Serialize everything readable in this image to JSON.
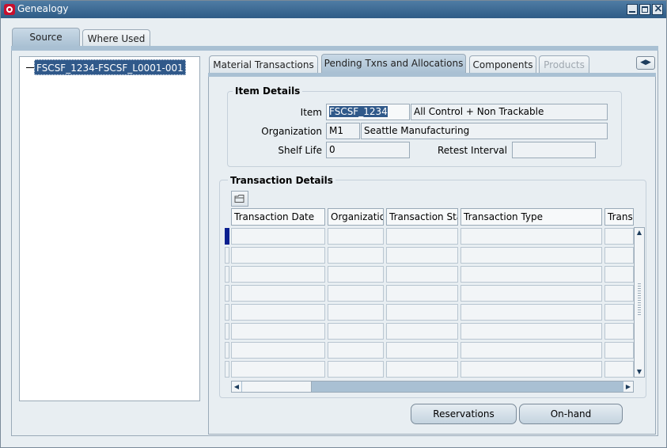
{
  "window": {
    "title": "Genealogy"
  },
  "outer_tabs": [
    {
      "label": "Source",
      "active": true
    },
    {
      "label": "Where Used",
      "active": false
    }
  ],
  "tree": {
    "node_label": "FSCSF_1234-FSCSF_L0001-001"
  },
  "inner_tabs": [
    {
      "label": "Material Transactions",
      "active": false,
      "disabled": false
    },
    {
      "label": "Pending Txns and Allocations",
      "active": true,
      "disabled": false
    },
    {
      "label": "Components",
      "active": false,
      "disabled": false
    },
    {
      "label": "Products",
      "active": false,
      "disabled": true
    }
  ],
  "item_details": {
    "title": "Item Details",
    "item_label": "Item",
    "item_value": "FSCSF_1234",
    "item_description": "All Control + Non Trackable",
    "org_label": "Organization",
    "org_code": "M1",
    "org_name": "Seattle Manufacturing",
    "shelf_life_label": "Shelf Life",
    "shelf_life_value": "0",
    "retest_label": "Retest Interval",
    "retest_value": ""
  },
  "transaction_details": {
    "title": "Transaction Details",
    "columns": [
      "Transaction Date",
      "Organization",
      "Transaction Status",
      "Transaction Type",
      "Transaction"
    ],
    "row_count": 8
  },
  "buttons": {
    "reservations": "Reservations",
    "onhand": "On-hand"
  },
  "colors": {
    "accent": "#30598a",
    "tab_active": "#a9c0d3",
    "background": "#e8eef2"
  }
}
